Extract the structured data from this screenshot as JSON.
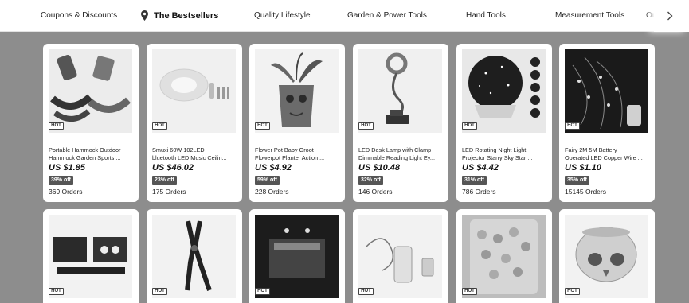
{
  "nav": {
    "items": [
      {
        "label": "Coupons & Discounts"
      },
      {
        "label": "The Bestsellers"
      },
      {
        "label": "Quality Lifestyle"
      },
      {
        "label": "Garden & Power Tools"
      },
      {
        "label": "Hand Tools"
      },
      {
        "label": "Measurement Tools"
      },
      {
        "label": "Ou"
      }
    ],
    "active_icon": "map-pin-icon",
    "scroll_icon": "chevron-right-icon"
  },
  "badge_label": "HOT",
  "products": [
    {
      "title_line1": "Portable Hammock Outdoor",
      "title_line2": "Hammock Garden Sports ...",
      "price": "US $1.85",
      "discount": "39% off",
      "orders": "369 Orders",
      "image": "hammock"
    },
    {
      "title_line1": "Smuxi 60W 102LED",
      "title_line2": "bluetooth LED Music Ceilin...",
      "price": "US $46.02",
      "discount": "23% off",
      "orders": "175 Orders",
      "image": "ceiling-light"
    },
    {
      "title_line1": "Flower Pot Baby Groot",
      "title_line2": "Flowerpot Planter Action ...",
      "price": "US $4.92",
      "discount": "59% off",
      "orders": "228 Orders",
      "image": "groot-pot"
    },
    {
      "title_line1": "LED Desk Lamp with Clamp",
      "title_line2": "Dimmable Reading Light Ey...",
      "price": "US $10.48",
      "discount": "32% off",
      "orders": "146 Orders",
      "image": "desk-lamp"
    },
    {
      "title_line1": "LED Rotating Night Light",
      "title_line2": "Projector Starry Sky Star ...",
      "price": "US $4.42",
      "discount": "31% off",
      "orders": "786 Orders",
      "image": "star-projector"
    },
    {
      "title_line1": "Fairy 2M 5M Battery",
      "title_line2": "Operated LED Copper Wire ...",
      "price": "US $1.10",
      "discount": "35% off",
      "orders": "15145 Orders",
      "image": "fairy-lights"
    },
    {
      "image": "solar-lights"
    },
    {
      "image": "pliers"
    },
    {
      "image": "led-strip-box"
    },
    {
      "image": "water-bottle-kit"
    },
    {
      "image": "foam-balls"
    },
    {
      "image": "skull-pot"
    }
  ]
}
